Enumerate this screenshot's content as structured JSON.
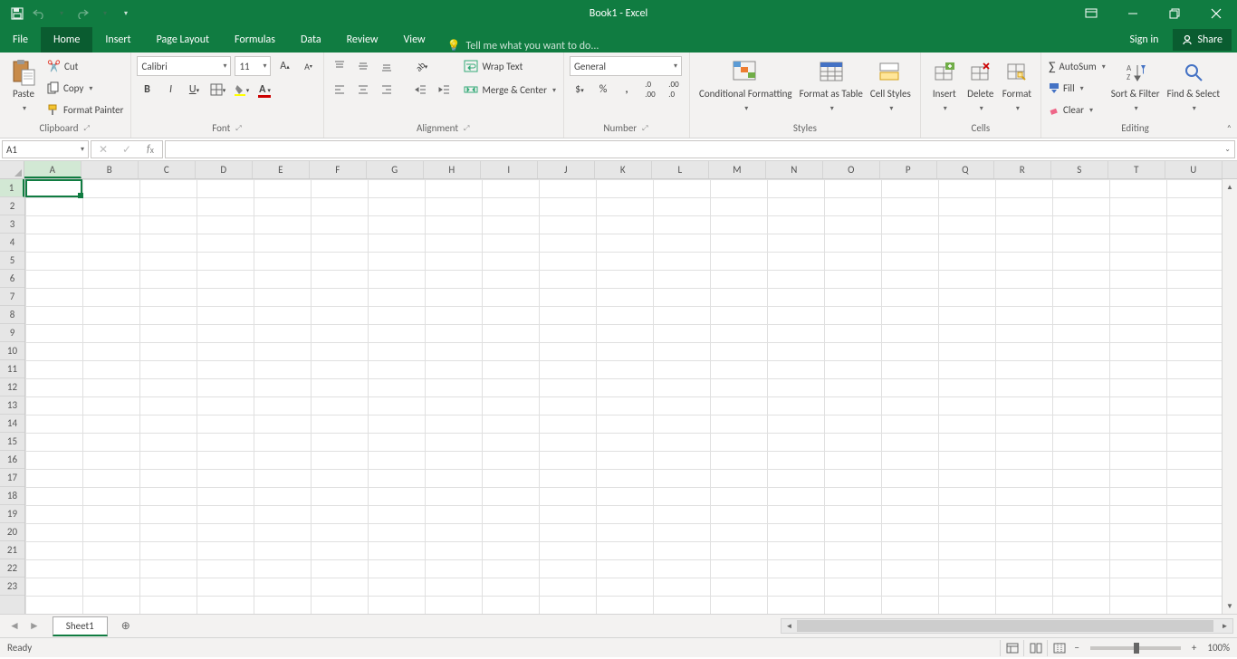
{
  "titlebar": {
    "title": "Book1 - Excel"
  },
  "tabs": {
    "file": "File",
    "items": [
      "Home",
      "Insert",
      "Page Layout",
      "Formulas",
      "Data",
      "Review",
      "View"
    ],
    "active": "Home",
    "tellme_placeholder": "Tell me what you want to do...",
    "signin": "Sign in",
    "share": "Share"
  },
  "ribbon": {
    "clipboard": {
      "paste": "Paste",
      "cut": "Cut",
      "copy": "Copy",
      "format_painter": "Format Painter",
      "label": "Clipboard"
    },
    "font": {
      "name": "Calibri",
      "size": "11",
      "label": "Font"
    },
    "alignment": {
      "wrap": "Wrap Text",
      "merge": "Merge & Center",
      "label": "Alignment"
    },
    "number": {
      "format": "General",
      "label": "Number"
    },
    "styles": {
      "cond": "Conditional Formatting",
      "table": "Format as Table",
      "cell": "Cell Styles",
      "label": "Styles"
    },
    "cells": {
      "insert": "Insert",
      "delete": "Delete",
      "format": "Format",
      "label": "Cells"
    },
    "editing": {
      "autosum": "AutoSum",
      "fill": "Fill",
      "clear": "Clear",
      "sort": "Sort & Filter",
      "find": "Find & Select",
      "label": "Editing"
    }
  },
  "namebox": "A1",
  "formula": "",
  "columns": [
    "A",
    "B",
    "C",
    "D",
    "E",
    "F",
    "G",
    "H",
    "I",
    "J",
    "K",
    "L",
    "M",
    "N",
    "O",
    "P",
    "Q",
    "R",
    "S",
    "T",
    "U"
  ],
  "rows": [
    1,
    2,
    3,
    4,
    5,
    6,
    7,
    8,
    9,
    10,
    11,
    12,
    13,
    14,
    15,
    16,
    17,
    18,
    19,
    20,
    21,
    22,
    23
  ],
  "sheet": {
    "active": "Sheet1"
  },
  "status": {
    "ready": "Ready",
    "zoom": "100%"
  }
}
